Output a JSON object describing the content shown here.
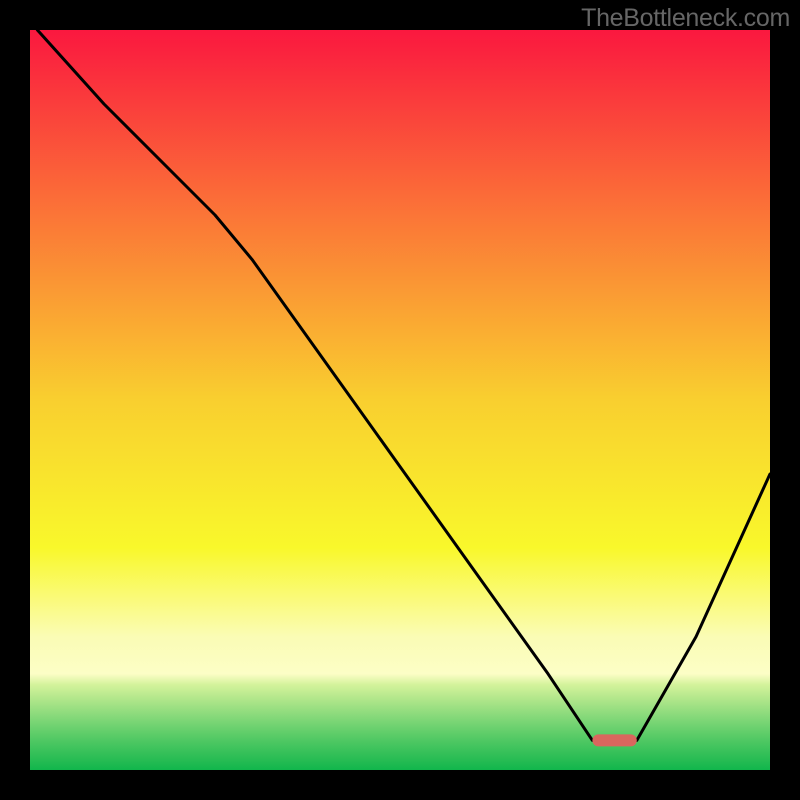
{
  "watermark_text": "TheBottleneck.com",
  "chart_data": {
    "type": "line",
    "title": "",
    "xlabel": "",
    "ylabel": "",
    "xlim": [
      0,
      100
    ],
    "ylim": [
      0,
      100
    ],
    "x": [
      1,
      10,
      20,
      25,
      30,
      40,
      50,
      60,
      70,
      76,
      82,
      90,
      100
    ],
    "values": [
      100,
      90,
      80,
      75,
      69,
      55,
      41,
      27,
      13,
      4,
      4,
      18,
      40
    ],
    "marker": {
      "x_start": 76,
      "x_end": 82,
      "y": 4,
      "color": "#d9675e"
    },
    "background": {
      "type": "vertical-gradient-with-bands",
      "stops": [
        {
          "pos": 0.0,
          "color": "#fa183f"
        },
        {
          "pos": 0.25,
          "color": "#fb7537"
        },
        {
          "pos": 0.5,
          "color": "#f9cf2f"
        },
        {
          "pos": 0.7,
          "color": "#f9f82b"
        },
        {
          "pos": 0.82,
          "color": "#fafcb5"
        },
        {
          "pos": 0.87,
          "color": "#fcfec6"
        },
        {
          "pos": 0.885,
          "color": "#d3f39b"
        },
        {
          "pos": 0.9,
          "color": "#b8e98e"
        },
        {
          "pos": 0.915,
          "color": "#9de083"
        },
        {
          "pos": 0.93,
          "color": "#82d878"
        },
        {
          "pos": 0.945,
          "color": "#68d06d"
        },
        {
          "pos": 0.96,
          "color": "#4fc863"
        },
        {
          "pos": 0.98,
          "color": "#31bf57"
        },
        {
          "pos": 1.0,
          "color": "#11b64c"
        }
      ]
    },
    "line_color": "#000000",
    "line_width": 3
  }
}
